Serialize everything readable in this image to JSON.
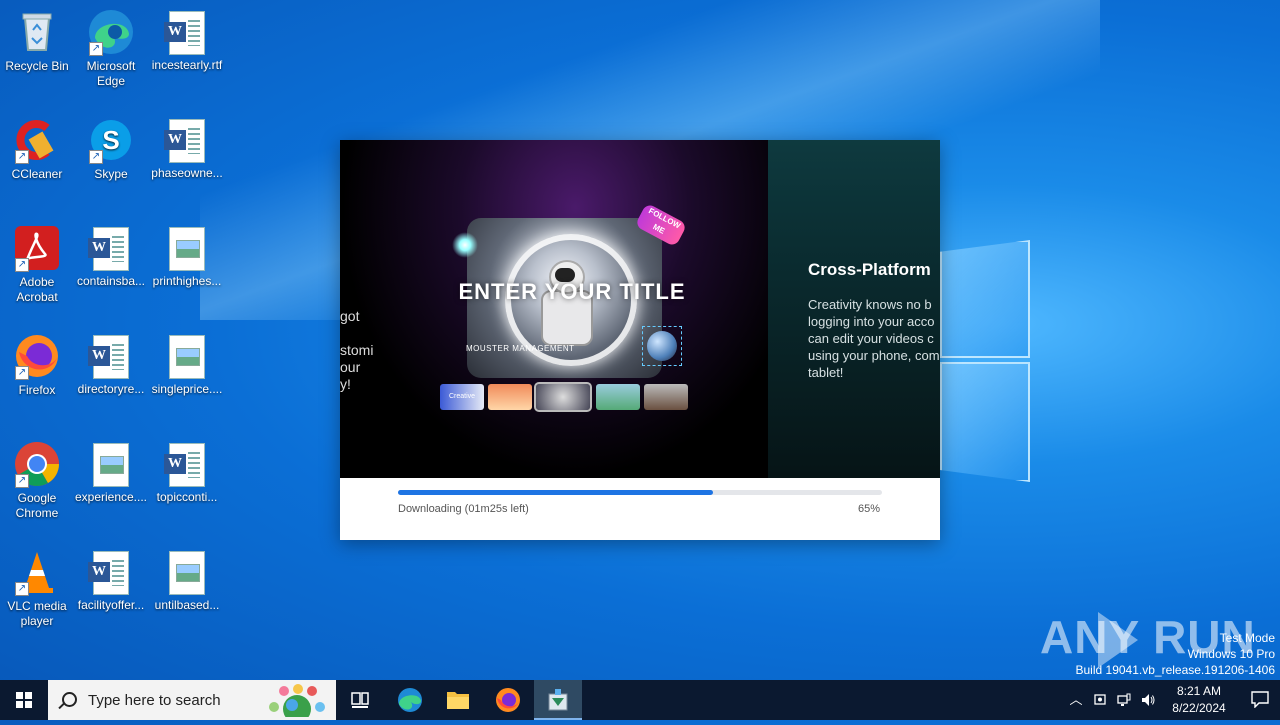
{
  "desktop": {
    "icons": [
      {
        "label": "Recycle Bin"
      },
      {
        "label": "Microsoft Edge"
      },
      {
        "label": "incestearly.rtf"
      },
      {
        "label": "CCleaner"
      },
      {
        "label": "Skype"
      },
      {
        "label": "phaseowne..."
      },
      {
        "label": "Adobe Acrobat"
      },
      {
        "label": "containsba..."
      },
      {
        "label": "printhighes..."
      },
      {
        "label": "Firefox"
      },
      {
        "label": "directoryre..."
      },
      {
        "label": "singleprice...."
      },
      {
        "label": "Google Chrome"
      },
      {
        "label": "experience...."
      },
      {
        "label": "topicconti..."
      },
      {
        "label": "VLC media player"
      },
      {
        "label": "facilityoffer..."
      },
      {
        "label": "untilbased..."
      }
    ]
  },
  "installer": {
    "banner": {
      "left_text_lines": [
        "got",
        "stomi",
        "our",
        "y!"
      ],
      "hero_title": "ENTER YOUR TITLE",
      "follow_badge": "FOLLOW ME",
      "brand_text": "MOUSTER MANAGEMENT",
      "thumb_badge": "Creative",
      "slide_title": "Cross-Platform",
      "slide_desc_lines": [
        "Creativity knows no b",
        "logging into your acco",
        "can edit your videos c",
        "using your phone, com",
        "tablet!"
      ]
    },
    "progress": {
      "status": "Downloading (01m25s left)",
      "percent_label": "65%",
      "value": 0.65
    }
  },
  "watermark": {
    "text": "ANY RUN"
  },
  "windows_info": {
    "line1": "Test Mode",
    "line2": "Windows 10 Pro",
    "line3": "Build 19041.vb_release.191206-1406"
  },
  "taskbar": {
    "search_placeholder": "Type here to search",
    "time": "8:21 AM",
    "date": "8/22/2024"
  },
  "colors": {
    "accent": "#1e74e3",
    "taskbar": "#0b1930",
    "desktop": "#0b6fd6"
  }
}
